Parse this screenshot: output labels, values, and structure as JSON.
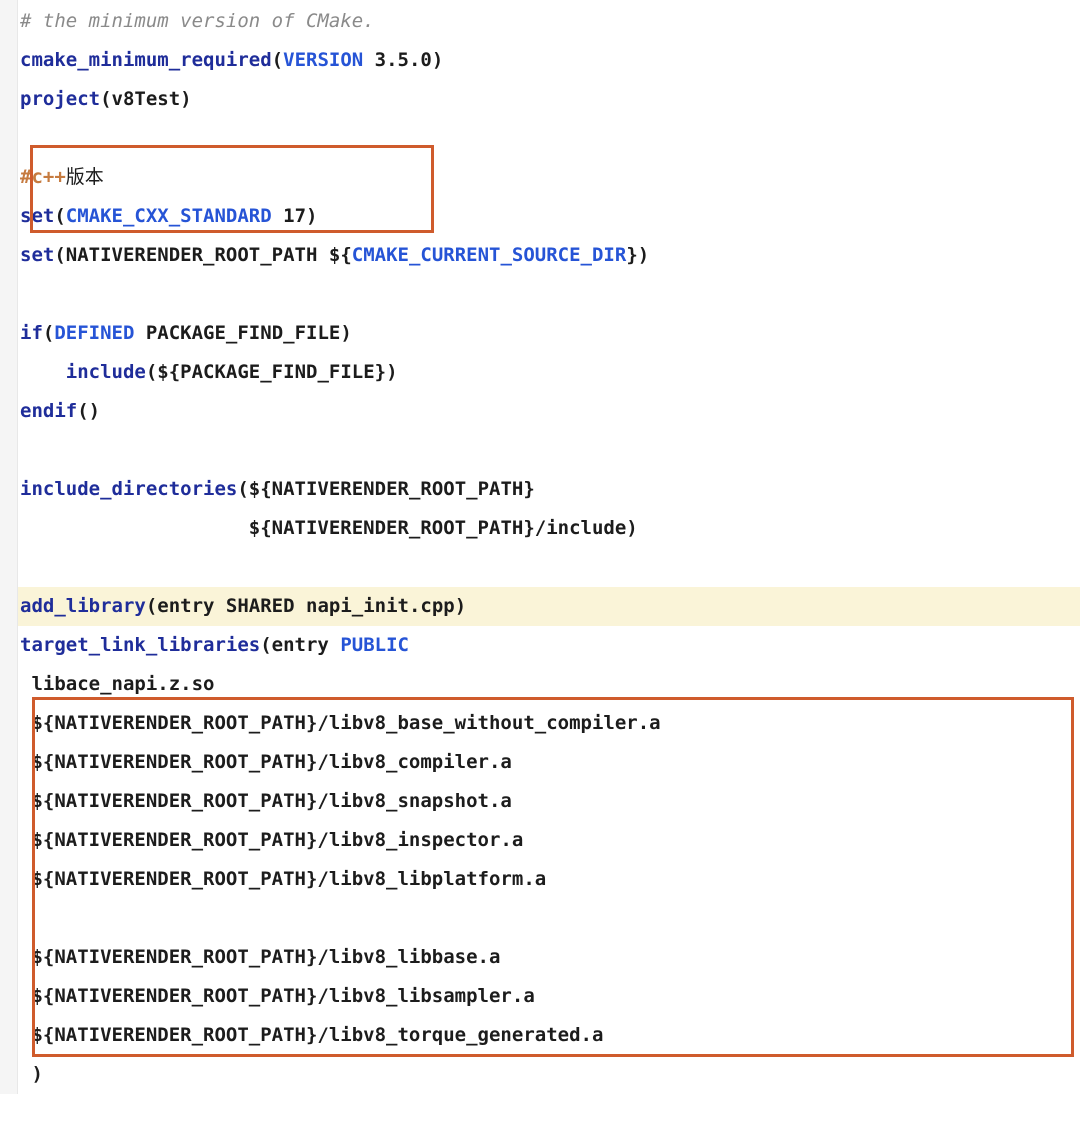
{
  "code": {
    "l1_comment": "# the minimum version of CMake.",
    "l2_kw": "cmake_minimum_required",
    "l2_arg": "VERSION",
    "l2_val": " 3.5.0",
    "l3_kw": "project",
    "l3_val": "v8Test",
    "l5_comment": "#c++",
    "l5_comment_tail": "版本",
    "l6_kw": "set",
    "l6_arg": "CMAKE_CXX_STANDARD",
    "l6_val": " 17",
    "l7_kw": "set",
    "l7_txt1": "NATIVERENDER_ROOT_PATH ${",
    "l7_arg": "CMAKE_CURRENT_SOURCE_DIR",
    "l7_txt2": "}",
    "l9_kw": "if",
    "l9_arg": "DEFINED",
    "l9_txt": " PACKAGE_FIND_FILE",
    "l10_indent": "    ",
    "l10_kw": "include",
    "l10_txt": "${PACKAGE_FIND_FILE}",
    "l11_kw": "endif",
    "l13_kw": "include_directories",
    "l13_txt": "${NATIVERENDER_ROOT_PATH}",
    "l14_indent": "                    ",
    "l14_txt": "${NATIVERENDER_ROOT_PATH}/include",
    "l16_kw": "add_library",
    "l16_txt": "entry SHARED napi_init.cpp",
    "l17_kw": "target_link_libraries",
    "l17_txt": "entry ",
    "l17_arg": "PUBLIC",
    "l18": " libace_napi.z.so",
    "l19": " ${NATIVERENDER_ROOT_PATH}/libv8_base_without_compiler.a",
    "l20": " ${NATIVERENDER_ROOT_PATH}/libv8_compiler.a",
    "l21": " ${NATIVERENDER_ROOT_PATH}/libv8_snapshot.a",
    "l22": " ${NATIVERENDER_ROOT_PATH}/libv8_inspector.a",
    "l23": " ${NATIVERENDER_ROOT_PATH}/libv8_libplatform.a",
    "l25": " ${NATIVERENDER_ROOT_PATH}/libv8_libbase.a",
    "l26": " ${NATIVERENDER_ROOT_PATH}/libv8_libsampler.a",
    "l27": " ${NATIVERENDER_ROOT_PATH}/libv8_torque_generated.a",
    "l28": " )"
  }
}
